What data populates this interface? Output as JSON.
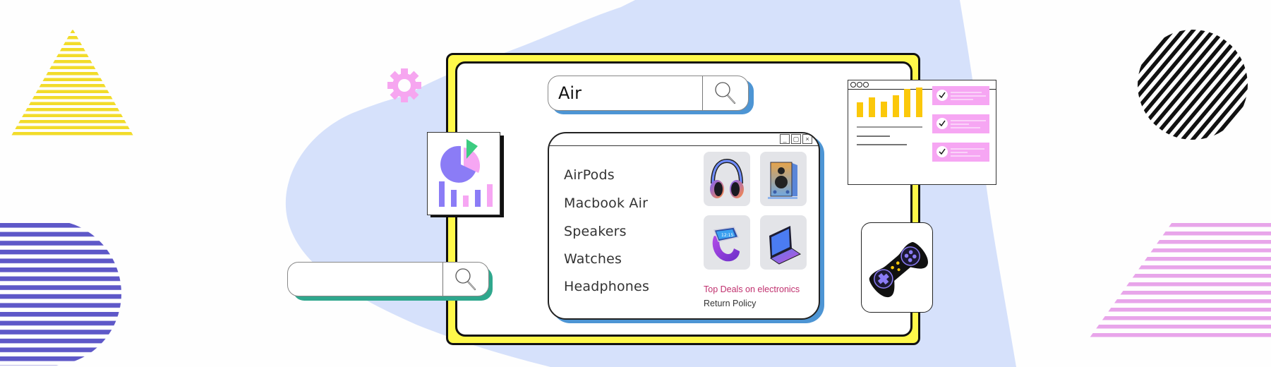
{
  "main_search": {
    "value": "Air",
    "button_icon": "magnifier-icon"
  },
  "secondary_search": {
    "value": "",
    "button_icon": "magnifier-icon"
  },
  "results_popup": {
    "window_controls": [
      "minimize",
      "maximize",
      "close"
    ],
    "window_control_glyphs": [
      "_",
      "▢",
      "×"
    ],
    "suggestions": [
      "AirPods",
      "Macbook Air",
      "Speakers",
      "Watches",
      "Headphones"
    ],
    "products": [
      {
        "name": "headphones",
        "icon": "headphones-icon"
      },
      {
        "name": "speaker",
        "icon": "speaker-icon"
      },
      {
        "name": "smartwatch",
        "icon": "smartwatch-icon"
      },
      {
        "name": "laptop",
        "icon": "laptop-icon"
      }
    ],
    "deals_link": "Top Deals on electronics",
    "policy_link": "Return Policy"
  },
  "dashboard_card": {
    "window_dots": 3,
    "checklist_items": 3,
    "check_glyph": "✓"
  },
  "colors": {
    "frame_yellow": "#fff84a",
    "blob_blue": "#d6e1fb",
    "accent_blue_shadow": "#4d95d4",
    "accent_teal_shadow": "#2fa78d",
    "gear_pink": "#f6a6f0",
    "deal_pink": "#c0306e",
    "chart_yellow": "#fbc80a",
    "check_pink": "#f6a6f3",
    "pie_purple": "#8b7cf6",
    "pie_green": "#3ccc80",
    "triangle_yellow": "#f2dc2a",
    "stripe_indigo": "#5e58c8",
    "stripe_pink": "#e8a5ea"
  }
}
